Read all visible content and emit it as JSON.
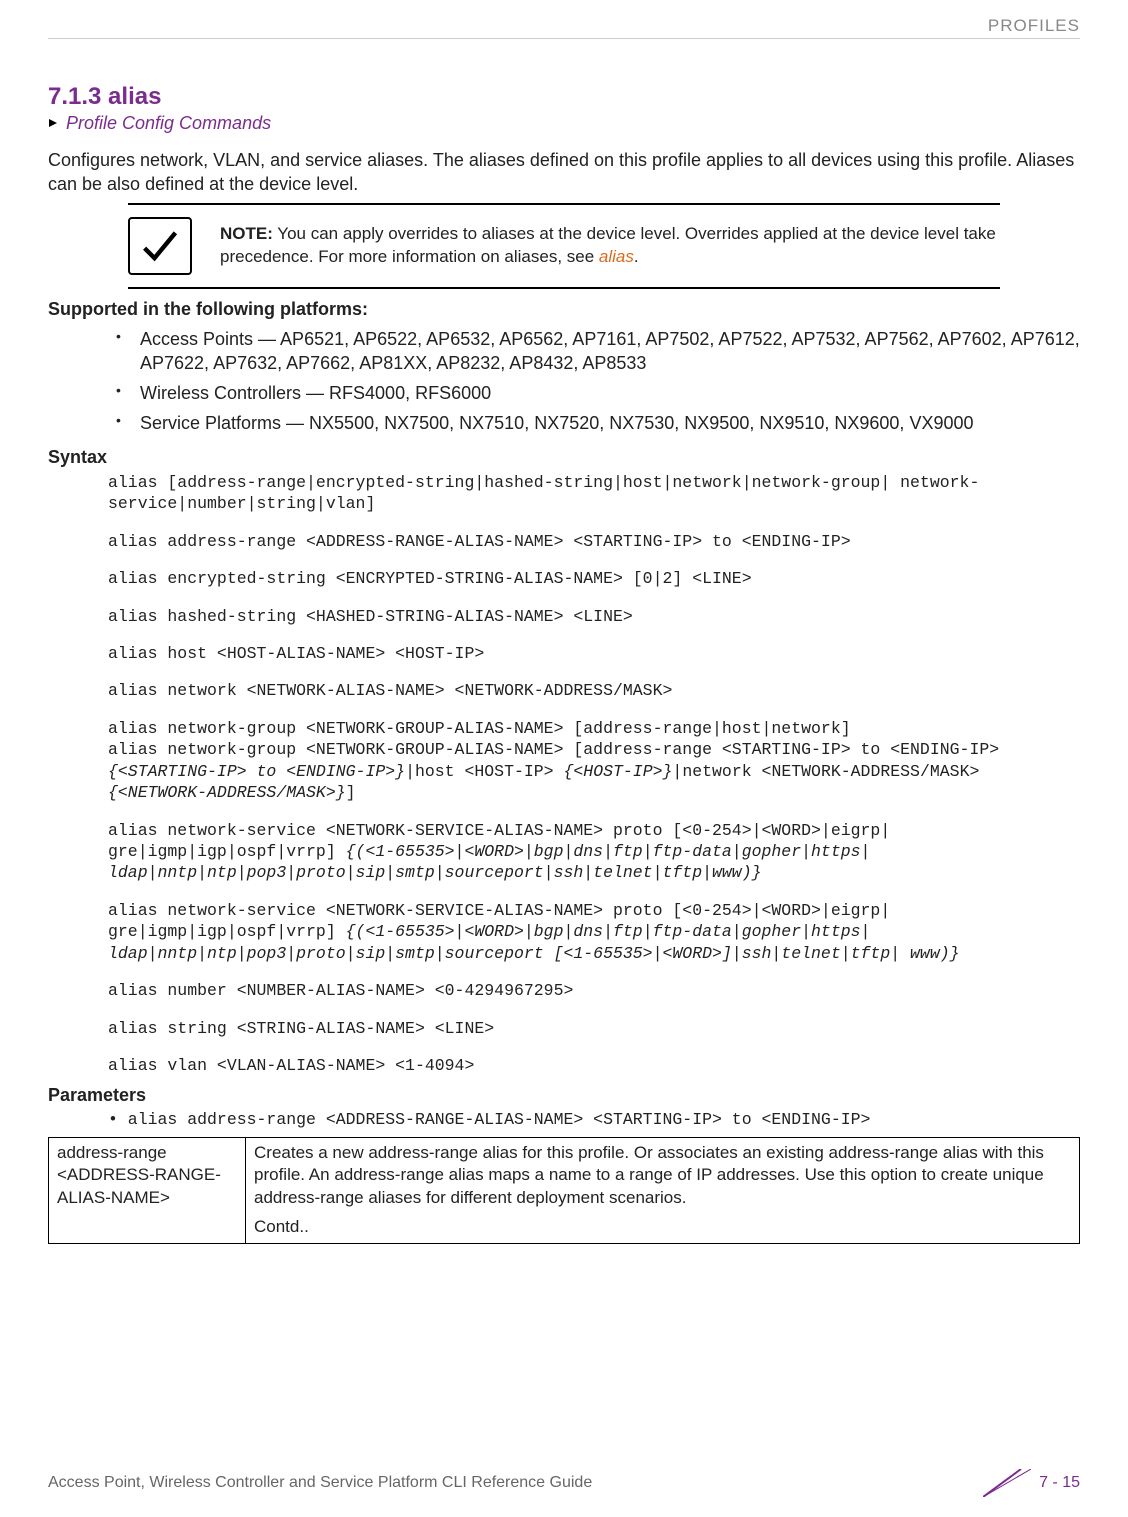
{
  "header_label": "PROFILES",
  "section_number_title": "7.1.3 alias",
  "breadcrumb": "Profile Config Commands",
  "description": "Configures network, VLAN, and service aliases. The aliases defined on this profile applies to all devices using this profile. Aliases can be also defined at the device level.",
  "note": {
    "label": "NOTE:",
    "body": " You can apply overrides to aliases at the device level. Overrides applied at the device level take precedence. For more information on aliases, see ",
    "link": "alias",
    "tail": "."
  },
  "platforms_heading": "Supported in the following platforms:",
  "platforms": [
    "Access Points — AP6521, AP6522, AP6532, AP6562, AP7161, AP7502, AP7522, AP7532, AP7562, AP7602, AP7612, AP7622, AP7632, AP7662, AP81XX, AP8232, AP8432, AP8533",
    "Wireless Controllers — RFS4000, RFS6000",
    "Service Platforms — NX5500, NX7500, NX7510, NX7520, NX7530, NX9500, NX9510, NX9600, VX9000"
  ],
  "syntax_heading": "Syntax",
  "syntax": {
    "l1": "alias [address-range|encrypted-string|hashed-string|host|network|network-group| network-service|number|string|vlan]",
    "l2": "alias address-range <ADDRESS-RANGE-ALIAS-NAME> <STARTING-IP> to <ENDING-IP>",
    "l3": "alias encrypted-string <ENCRYPTED-STRING-ALIAS-NAME> [0|2] <LINE>",
    "l4": "alias hashed-string <HASHED-STRING-ALIAS-NAME> <LINE>",
    "l5": "alias host <HOST-ALIAS-NAME> <HOST-IP>",
    "l6": "alias network <NETWORK-ALIAS-NAME> <NETWORK-ADDRESS/MASK>",
    "l7a": "alias network-group <NETWORK-GROUP-ALIAS-NAME> [address-range|host|network]",
    "l7b": "alias network-group <NETWORK-GROUP-ALIAS-NAME> [address-range <STARTING-IP> to <ENDING-IP> ",
    "l7b_i": "{<STARTING-IP> to <ENDING-IP>}",
    "l7c": "|host <HOST-IP> ",
    "l7c_i": "{<HOST-IP>}",
    "l7d": "|network <NETWORK-ADDRESS/MASK> ",
    "l7d_i": "{<NETWORK-ADDRESS/MASK>}",
    "l7e": "]",
    "l8a": "alias network-service <NETWORK-SERVICE-ALIAS-NAME> proto [<0-254>|<WORD>|eigrp| gre|igmp|igp|ospf|vrrp] ",
    "l8a_i": "{(<1-65535>|<WORD>|bgp|dns|ftp|ftp-data|gopher|https| ldap|nntp|ntp|pop3|proto|sip|smtp|sourceport|ssh|telnet|tftp|www)}",
    "l9a": "alias network-service <NETWORK-SERVICE-ALIAS-NAME> proto [<0-254>|<WORD>|eigrp| gre|igmp|igp|ospf|vrrp] ",
    "l9a_i": "{(<1-65535>|<WORD>|bgp|dns|ftp|ftp-data|gopher|https| ldap|nntp|ntp|pop3|proto|sip|smtp|sourceport [<1-65535>|<WORD>]|ssh|telnet|tftp| www)}",
    "l10": "alias number <NUMBER-ALIAS-NAME> <0-4294967295>",
    "l11": "alias string <STRING-ALIAS-NAME> <LINE>",
    "l12": "alias vlan <VLAN-ALIAS-NAME> <1-4094>"
  },
  "params_heading": "Parameters",
  "param_line": "• alias address-range <ADDRESS-RANGE-ALIAS-NAME> <STARTING-IP> to <ENDING-IP>",
  "param_table": {
    "c1": "address-range <ADDRESS-RANGE-ALIAS-NAME>",
    "c2a": "Creates a new address-range alias for this profile. Or associates an existing address-range alias with this profile. An address-range alias maps a name to a range of IP addresses. Use this option to create unique address-range aliases for different deployment scenarios.",
    "c2b": "Contd.."
  },
  "footer_left": "Access Point, Wireless Controller and Service Platform CLI Reference Guide",
  "footer_right": "7 - 15"
}
